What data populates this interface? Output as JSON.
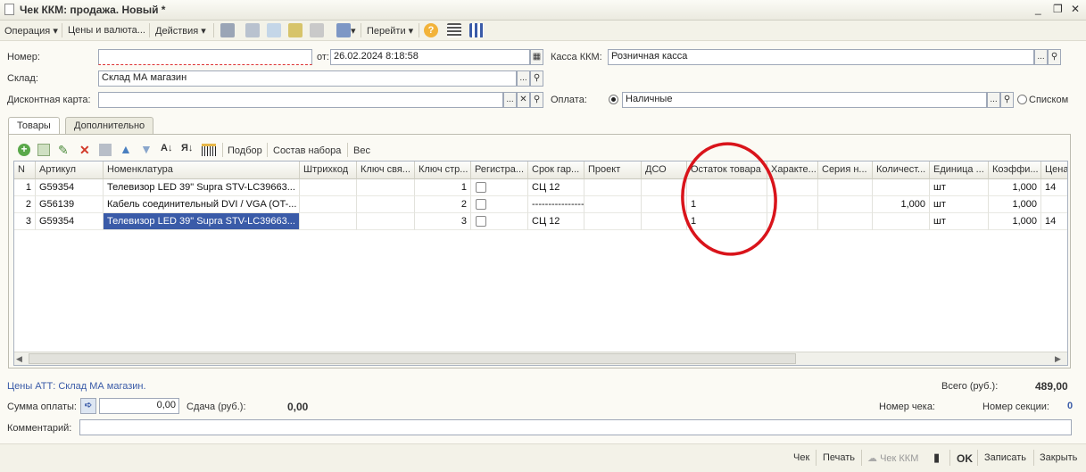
{
  "window": {
    "title": "Чек ККМ: продажа. Новый *"
  },
  "toolbar": {
    "operation": "Операция",
    "prices": "Цены и валюта...",
    "actions": "Действия",
    "goto": "Перейти"
  },
  "form": {
    "number_label": "Номер:",
    "number_value": "",
    "date_label": "от:",
    "date_value": "26.02.2024  8:18:58",
    "kkm_label": "Касса ККМ:",
    "kkm_value": "Розничная касса",
    "warehouse_label": "Склад:",
    "warehouse_value": "Склад МА магазин",
    "discount_label": "Дисконтная карта:",
    "discount_value": "",
    "payment_label": "Оплата:",
    "payment_value": "Наличные",
    "list_label": "Списком"
  },
  "tabs": [
    "Товары",
    "Дополнительно"
  ],
  "grid_toolbar": {
    "pick": "Подбор",
    "kit": "Состав набора",
    "weight": "Вес"
  },
  "table": {
    "columns": [
      "N",
      "Артикул",
      "Номенклатура",
      "Штрихкод",
      "Ключ свя...",
      "Ключ стр...",
      "Регистра...",
      "Срок гар...",
      "Проект",
      "ДСО",
      "Остаток товара",
      "Характе...",
      "Серия н...",
      "Количест...",
      "Единица ...",
      "Коэффи...",
      "Цена"
    ],
    "rows": [
      {
        "n": "1",
        "article": "G59354",
        "name": "Телевизор LED 39\" Supra STV-LC39663...",
        "barcode": "",
        "key1": "",
        "key2": "1",
        "warranty": "СЦ 12",
        "project": "",
        "dso": "",
        "stock": "",
        "char": "",
        "series": "",
        "qty": "",
        "unit": "шт",
        "coef": "1,000",
        "price": "14"
      },
      {
        "n": "2",
        "article": "G56139",
        "name": "Кабель соединительный DVI / VGA (OT-...",
        "barcode": "",
        "key1": "",
        "key2": "2",
        "warranty": "----------------",
        "project": "",
        "dso": "",
        "stock": "1",
        "char": "",
        "series": "",
        "qty": "1,000",
        "unit": "шт",
        "coef": "1,000",
        "price": ""
      },
      {
        "n": "3",
        "article": "G59354",
        "name": "Телевизор LED 39\" Supra STV-LC39663...",
        "barcode": "",
        "key1": "",
        "key2": "3",
        "warranty": "СЦ 12",
        "project": "",
        "dso": "",
        "stock": "1",
        "char": "",
        "series": "",
        "qty": "",
        "unit": "шт",
        "coef": "1,000",
        "price": "14"
      }
    ]
  },
  "footer": {
    "prices_link": "Цены АТТ: Склад МА магазин.",
    "total_label": "Всего (руб.):",
    "total_value": "489,00",
    "payment_sum_label": "Сумма оплаты:",
    "payment_sum_value": "0,00",
    "change_label": "Сдача (руб.):",
    "change_value": "0,00",
    "check_no_label": "Номер чека:",
    "section_label": "Номер секции:",
    "section_value": "0",
    "comment_label": "Комментарий:",
    "comment_value": ""
  },
  "bottom": {
    "check": "Чек",
    "print": "Печать",
    "kkm_check": "Чек ККМ",
    "ok": "OK",
    "save": "Записать",
    "close": "Закрыть"
  },
  "colors": {
    "accent": "#3a5ba8",
    "annotation": "#d9141b"
  }
}
